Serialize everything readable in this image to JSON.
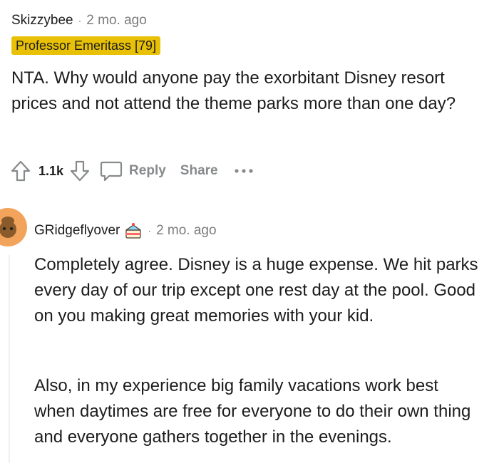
{
  "comment": {
    "username": "Skizzybee",
    "separator": "·",
    "timestamp": "2 mo. ago",
    "flair": "Professor Emeritass [79]",
    "body": "NTA. Why would anyone pay the exorbitant Disney resort prices and not attend the theme parks more than one day?",
    "actions": {
      "upvote_icon": "upvote-arrow-icon",
      "vote_count": "1.1k",
      "downvote_icon": "downvote-arrow-icon",
      "reply_icon": "speech-bubble-icon",
      "reply_label": "Reply",
      "share_label": "Share",
      "more_label": "•••"
    }
  },
  "reply": {
    "username": "GRidgeflyover",
    "badge_icon": "cake-day-icon",
    "separator": "·",
    "timestamp": "2 mo. ago",
    "paragraphs": [
      "Completely agree. Disney is a huge expense. We hit parks every day of our trip except one rest day at the pool. Good on you making great memories with your kid.",
      "Also, in my experience big family vacations work best when daytimes are free for everyone to do their own thing and everyone gathers together in the evenings."
    ]
  },
  "colors": {
    "flair_bg": "#e8c107",
    "muted_text": "#7c7c7c",
    "action_gray": "#878a8c",
    "avatar_orange": "#f3a45c"
  }
}
